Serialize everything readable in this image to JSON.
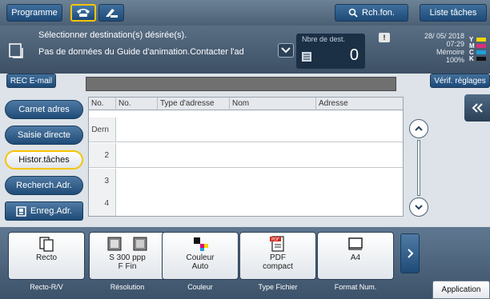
{
  "tabs": {
    "programme": "Programme",
    "search": "Rch.fon.",
    "jobs": "Liste tâches"
  },
  "info": {
    "line1": "Sélectionner destination(s) désirée(s).",
    "line2": "Pas de données du Guide d'animation.Contacter l'ad",
    "dest_label": "Nbre de dest.",
    "dest_count": "0",
    "alert": "!",
    "date": "28/ 05/ 2018",
    "time": "07:29",
    "memory_label": "Mémoire",
    "memory_value": "100%"
  },
  "toner": [
    {
      "letter": "Y",
      "color": "#f2d600"
    },
    {
      "letter": "M",
      "color": "#d8307c"
    },
    {
      "letter": "C",
      "color": "#1ea0d8"
    },
    {
      "letter": "K",
      "color": "#111111"
    }
  ],
  "rec_button": "REC E-mail",
  "verif_button": "Vérif. réglages",
  "sidebar": [
    {
      "label": "Carnet adres",
      "active": false
    },
    {
      "label": "Saisie directe",
      "active": false
    },
    {
      "label": "Histor.tâches",
      "active": true
    },
    {
      "label": "Recherch.Adr.",
      "active": false
    }
  ],
  "enreg_button": "Enreg.Adr.",
  "table": {
    "headers": [
      "No.",
      "No.",
      "Type d'adresse",
      "Nom",
      "Adresse"
    ],
    "rows": [
      "Dern",
      "2",
      "3",
      "4"
    ]
  },
  "functions": [
    {
      "value1": "Recto",
      "value2": "",
      "label": "Recto-R/V",
      "icon": "duplex-icon"
    },
    {
      "value1": "S 300 ppp",
      "value2": "F Fin",
      "label": "Résolution",
      "icon": "resolution-icon"
    },
    {
      "value1": "Couleur",
      "value2": "Auto",
      "label": "Couleur",
      "icon": "color-icon"
    },
    {
      "value1": "PDF",
      "value2": "compact",
      "label": "Type Fichier",
      "icon": "pdf-icon"
    },
    {
      "value1": "A4",
      "value2": "",
      "label": "Format Num.",
      "icon": "paper-size-icon"
    }
  ],
  "application_tab": "Application"
}
